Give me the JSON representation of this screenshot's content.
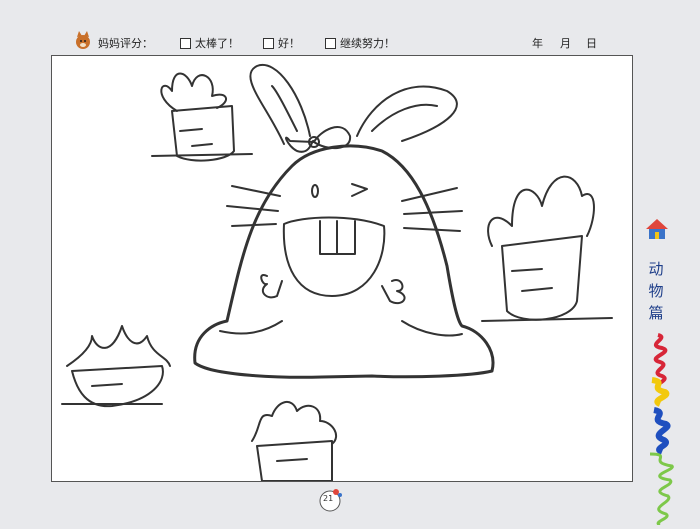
{
  "header": {
    "rating_label": "妈妈评分：",
    "options": [
      "太棒了！",
      "好！",
      "继续努力！"
    ],
    "date": {
      "year": "年",
      "month": "月",
      "day": "日"
    }
  },
  "side": {
    "title_chars": [
      "动",
      "物",
      "篇"
    ]
  },
  "page": {
    "number": "21"
  },
  "colors": {
    "title": "#1f3f8a",
    "frame_border": "#555555",
    "background": "#e8e9ec"
  }
}
